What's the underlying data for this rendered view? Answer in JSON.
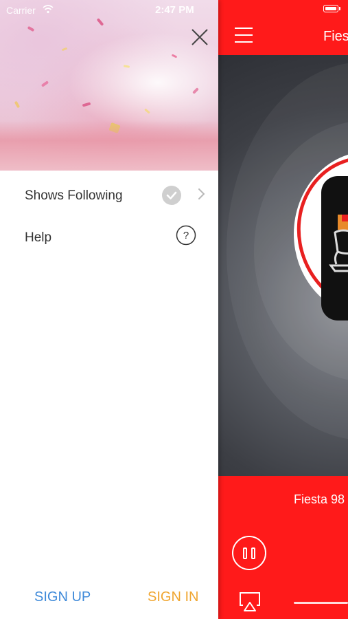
{
  "status_bar": {
    "carrier": "Carrier",
    "time": "2:47 PM"
  },
  "drawer": {
    "menu_items": [
      {
        "label": "Shows Following",
        "icon": "checkmark-icon",
        "has_chevron": true
      },
      {
        "label": "Help",
        "icon": "help-icon"
      }
    ],
    "sign_up": "SIGN UP",
    "sign_in": "SIGN IN"
  },
  "player": {
    "title": "Fies",
    "now_playing": "Fiesta 98",
    "accent_color": "#ff1a1a"
  },
  "colors": {
    "sign_up": "#3f8ad9",
    "sign_in": "#f0a631"
  }
}
